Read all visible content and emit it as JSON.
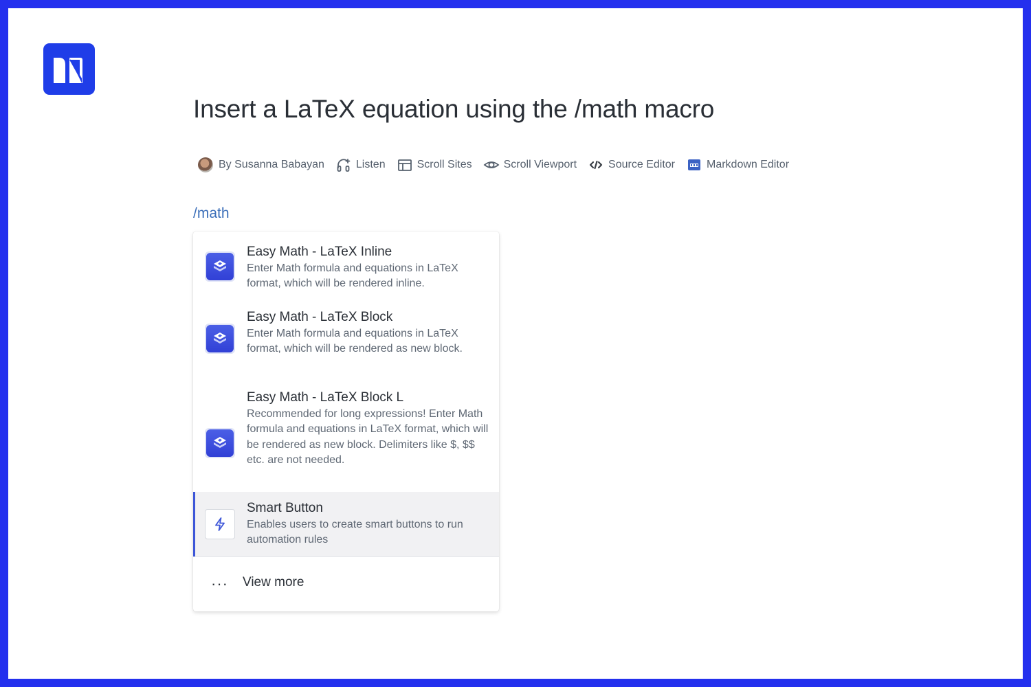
{
  "page": {
    "title": "Insert a LaTeX equation using the /math macro",
    "border_color": "#2430ee"
  },
  "logo": {
    "icon": "brand-logo-icon",
    "color": "#1f3de8"
  },
  "byline": {
    "author": "By Susanna Babayan",
    "items": [
      {
        "label": "Listen",
        "icon": "headphones-icon"
      },
      {
        "label": "Scroll Sites",
        "icon": "layout-icon"
      },
      {
        "label": "Scroll Viewport",
        "icon": "eye-icon"
      },
      {
        "label": "Source Editor",
        "icon": "code-icon"
      },
      {
        "label": "Markdown Editor",
        "icon": "markdown-icon"
      }
    ]
  },
  "editor": {
    "slash_command": "/math"
  },
  "menu": {
    "items": [
      {
        "title": "Easy Math - LaTeX Inline",
        "description": "Enter Math formula and equations in LaTeX format, which will be rendered inline.",
        "icon": "easy-math-icon"
      },
      {
        "title": "Easy Math - LaTeX Block",
        "description": "Enter Math formula and equations in LaTeX format, which will be rendered as new block.",
        "icon": "easy-math-icon"
      },
      {
        "title": "Easy Math - LaTeX Block L",
        "description": "Recommended for long expressions! Enter Math formula and equations in LaTeX format, which will be rendered as new block. Delimiters like $, $$ etc. are not needed.",
        "icon": "easy-math-icon"
      },
      {
        "title": "Smart Button",
        "description": "Enables users to create smart buttons to run automation rules",
        "icon": "lightning-icon",
        "selected": true
      }
    ],
    "view_more": "View more",
    "accent_color": "#3d56d8"
  }
}
